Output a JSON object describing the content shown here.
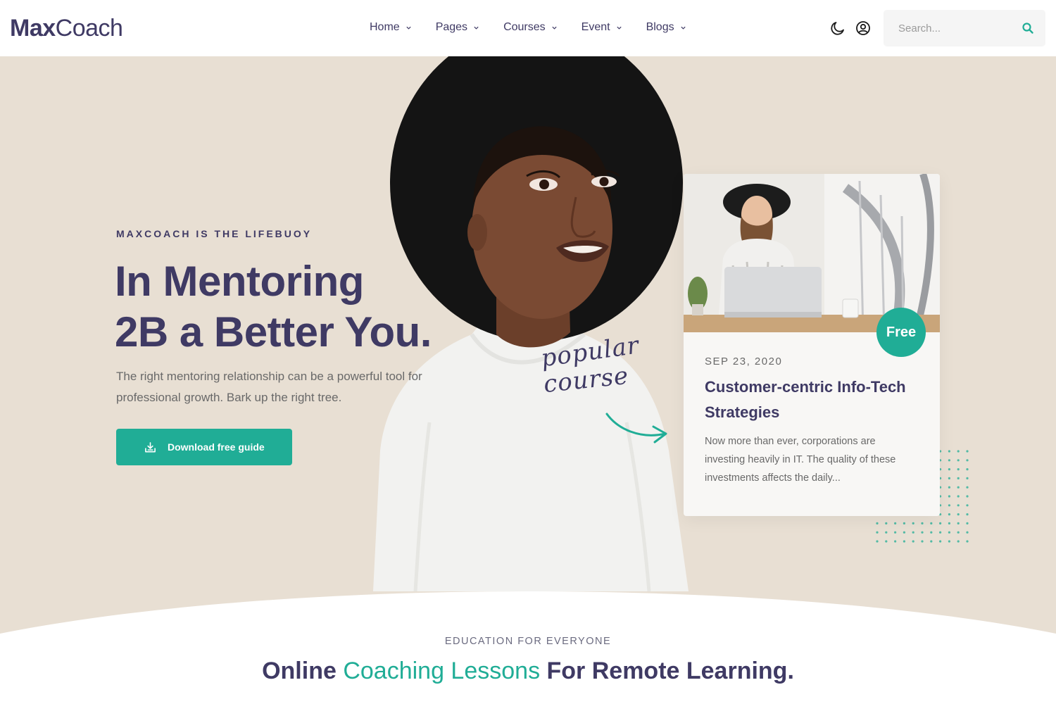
{
  "brand": {
    "logo_bold": "Max",
    "logo_light": "Coach"
  },
  "nav": {
    "items": [
      {
        "label": "Home"
      },
      {
        "label": "Pages"
      },
      {
        "label": "Courses"
      },
      {
        "label": "Event"
      },
      {
        "label": "Blogs"
      }
    ]
  },
  "header": {
    "icons": [
      "moon-icon",
      "user-icon"
    ],
    "search": {
      "placeholder": "Search..."
    }
  },
  "hero": {
    "eyebrow": "MAXCOACH IS THE LIFEBUOY",
    "title_line1": "In Mentoring",
    "title_line2": "2B a Better You.",
    "lead": "The right mentoring relationship can be a powerful tool for professional growth. Bark up the right tree.",
    "cta_label": "Download free guide",
    "handwriting_line1": "popular",
    "handwriting_line2": "course"
  },
  "course_card": {
    "badge": "Free",
    "date": "SEP 23, 2020",
    "title": "Customer-centric Info-Tech Strategies",
    "excerpt": "Now more than ever, corporations are investing heavily in IT. The quality of these investments affects the daily..."
  },
  "section": {
    "eyebrow": "EDUCATION FOR EVERYONE",
    "headline_part1": "Online ",
    "headline_accent": "Coaching Lessons",
    "headline_part2": " For Remote Learning."
  },
  "colors": {
    "primary": "#3f3a64",
    "accent": "#20ad96",
    "hero_bg": "#e8dfd3",
    "text_muted": "#696969"
  }
}
